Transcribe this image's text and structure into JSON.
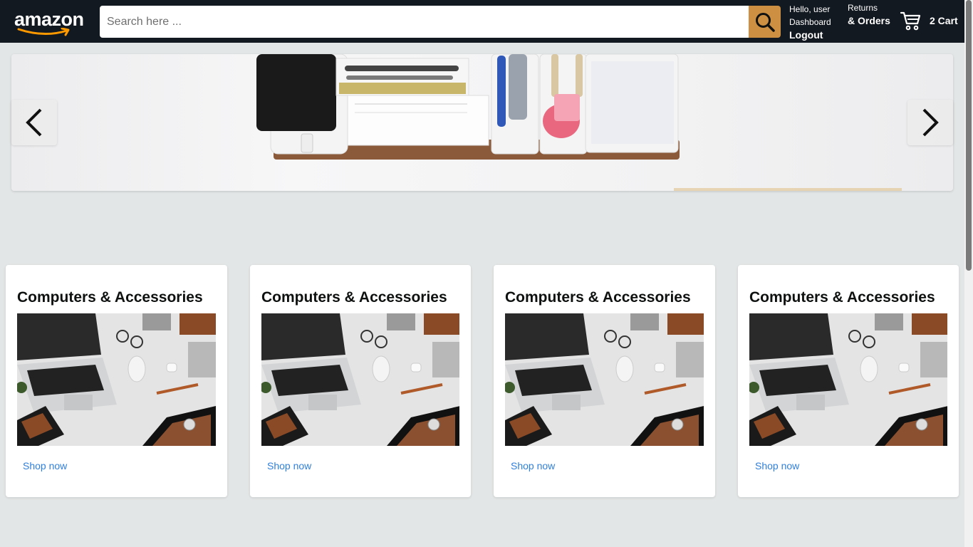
{
  "navbar": {
    "logo_text": "amazon",
    "search": {
      "placeholder": "Search here ...",
      "value": "",
      "icon": "search-icon"
    },
    "account": {
      "greeting": "Hello, user",
      "dashboard": "Dashboard",
      "logout": "Logout"
    },
    "returns": {
      "line1": "Returns",
      "line2": "& Orders"
    },
    "cart": {
      "label": "2 Cart",
      "icon": "cart-icon"
    }
  },
  "banner": {
    "prev_icon": "chevron-left-icon",
    "next_icon": "chevron-right-icon"
  },
  "cards": [
    {
      "title": "Computers & Accessories",
      "link": "Shop now"
    },
    {
      "title": "Computers & Accessories",
      "link": "Shop now"
    },
    {
      "title": "Computers & Accessories",
      "link": "Shop now"
    },
    {
      "title": "Computers & Accessories",
      "link": "Shop now"
    }
  ],
  "colors": {
    "navbar_bg": "#131921",
    "search_button": "#cd9042",
    "page_bg": "#e3e6e6",
    "link": "#2f7fdc"
  }
}
